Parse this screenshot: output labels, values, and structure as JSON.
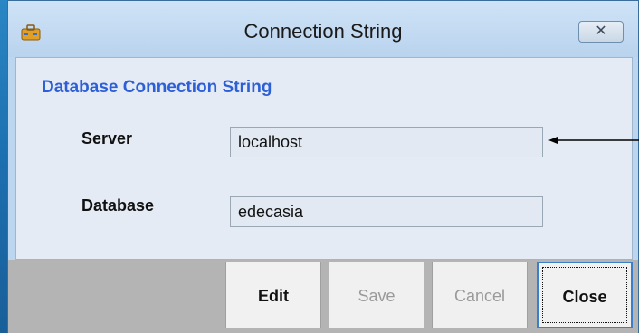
{
  "window": {
    "title": "Connection String",
    "close_glyph": "✕",
    "icon": "app-toolbox-icon"
  },
  "group": {
    "title": "Database Connection String"
  },
  "fields": {
    "server": {
      "label": "Server",
      "value": "localhost"
    },
    "database": {
      "label": "Database",
      "value": "edecasia"
    }
  },
  "buttons": {
    "edit": "Edit",
    "save": "Save",
    "cancel": "Cancel",
    "close": "Close"
  },
  "colors": {
    "group_title": "#2d5fd6",
    "desktop": "#1c6fae"
  }
}
